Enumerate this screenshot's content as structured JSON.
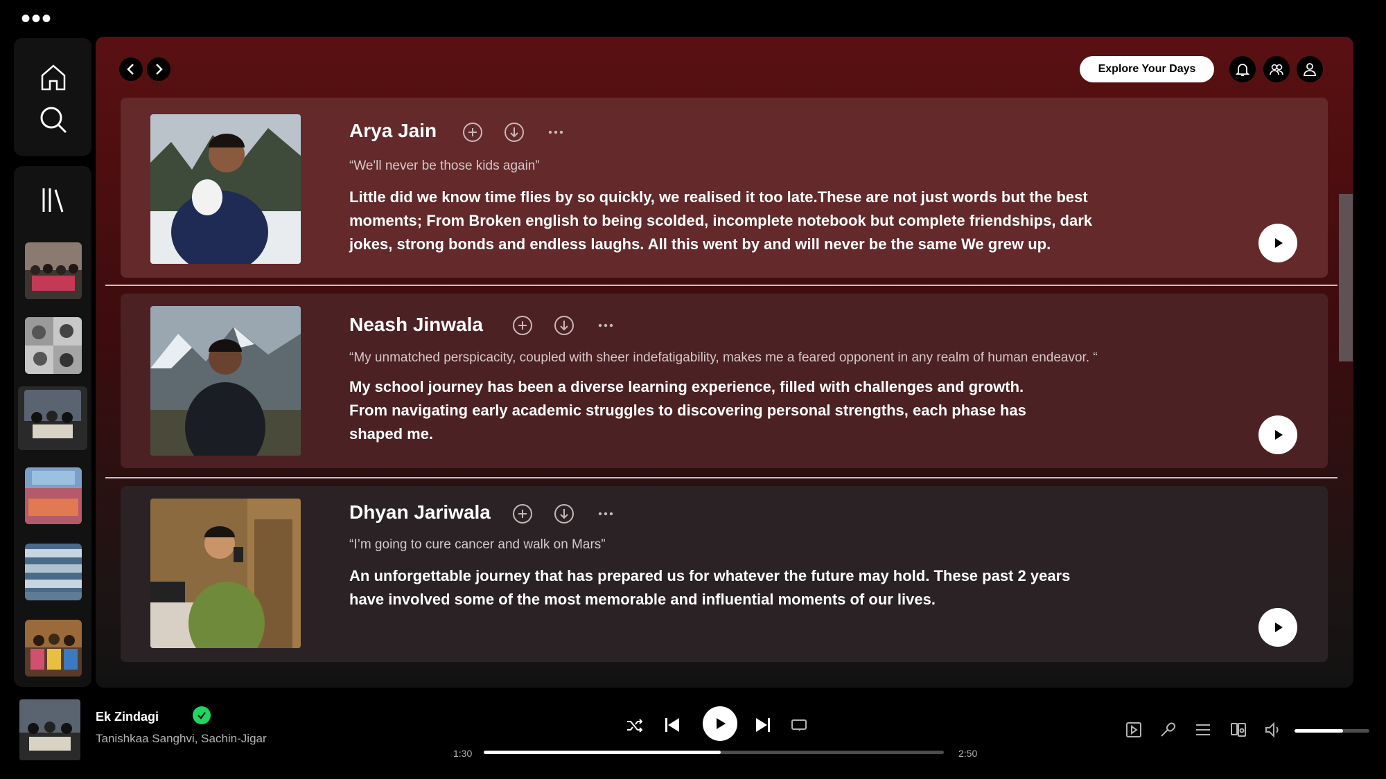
{
  "window": {
    "menu_dots": "•••"
  },
  "header": {
    "explore_button": "Explore Your Days"
  },
  "cards": [
    {
      "name": "Arya Jain",
      "quote": "“We'll never be those kids again”",
      "body": "Little did we know time flies by so quickly, we realised it too late.These are not just words but the best moments; From Broken english to being scolded, incomplete notebook but complete friendships, dark jokes, strong bonds and endless laughs. All this went by and will never be the same We grew up."
    },
    {
      "name": "Neash Jinwala",
      "quote": "“My unmatched perspicacity, coupled with sheer indefatigability, makes me a feared opponent in any realm of human endeavor. “",
      "body": "My school journey has been a diverse learning experience, filled with challenges and growth. From navigating early academic struggles to discovering personal strengths, each phase has shaped me."
    },
    {
      "name": "Dhyan Jariwala",
      "quote": "“I’m going to cure cancer and walk on Mars”",
      "body": "An unforgettable journey that has prepared us for whatever the future may hold. These past 2 years have involved some of the most memorable and influential moments of our lives."
    }
  ],
  "now_playing": {
    "title": "Ek Zindagi",
    "artist": "Tanishkaa Sanghvi, Sachin-Jigar",
    "elapsed": "1:30",
    "duration": "2:50",
    "progress": 0.515,
    "volume": 0.65
  },
  "colors": {
    "accent": "#1ed760",
    "main_top": "#5a1012"
  }
}
